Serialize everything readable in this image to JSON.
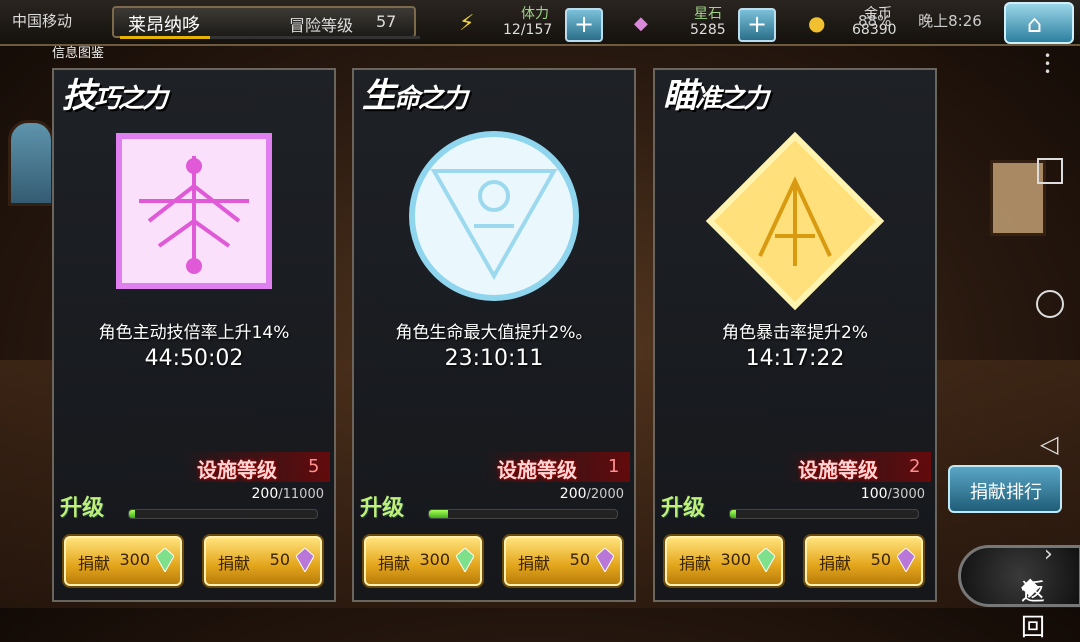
{
  "status": {
    "carrier": "中国移动",
    "battery": "88%",
    "time": "晚上8:26"
  },
  "player": {
    "name": "莱昂纳哆",
    "level_label": "冒险等级",
    "level": "57"
  },
  "resources": [
    {
      "label": "体力",
      "value": "12/157",
      "icon": "lightning-icon"
    },
    {
      "label": "星石",
      "value": "5285",
      "icon": "crystal-icon"
    },
    {
      "label": "金币",
      "value": "68390",
      "icon": "coin-icon"
    }
  ],
  "info_tab": "信息图鉴",
  "panels": [
    {
      "title_main": "技",
      "title_rest": "巧之力",
      "desc": "角色主动技倍率上升14%",
      "timer": "44:50:02",
      "facility_label": "设施等级",
      "facility_level": "5",
      "upgrade_label": "升级",
      "progress_current": "200",
      "progress_max": "/11000",
      "progress_fraction": 0.018,
      "donate_label": "捐献",
      "donate_a_value": "300",
      "donate_b_value": "50",
      "accent": "#e96cf0"
    },
    {
      "title_main": "生",
      "title_rest": "命之力",
      "desc": "角色生命最大值提升2%。",
      "timer": "23:10:11",
      "facility_label": "设施等级",
      "facility_level": "1",
      "upgrade_label": "升级",
      "progress_current": "200",
      "progress_max": "/2000",
      "progress_fraction": 0.1,
      "donate_label": "捐献",
      "donate_a_value": "300",
      "donate_b_value": "50",
      "accent": "#bfe8f5"
    },
    {
      "title_main": "瞄",
      "title_rest": "准之力",
      "desc": "角色暴击率提升2%",
      "timer": "14:17:22",
      "facility_label": "设施等级",
      "facility_level": "2",
      "upgrade_label": "升级",
      "progress_current": "100",
      "progress_max": "/3000",
      "progress_fraction": 0.033,
      "donate_label": "捐献",
      "donate_a_value": "300",
      "donate_b_value": "50",
      "accent": "#ffd24a"
    }
  ],
  "rank_button": "捐献排行",
  "back_button": "返回"
}
